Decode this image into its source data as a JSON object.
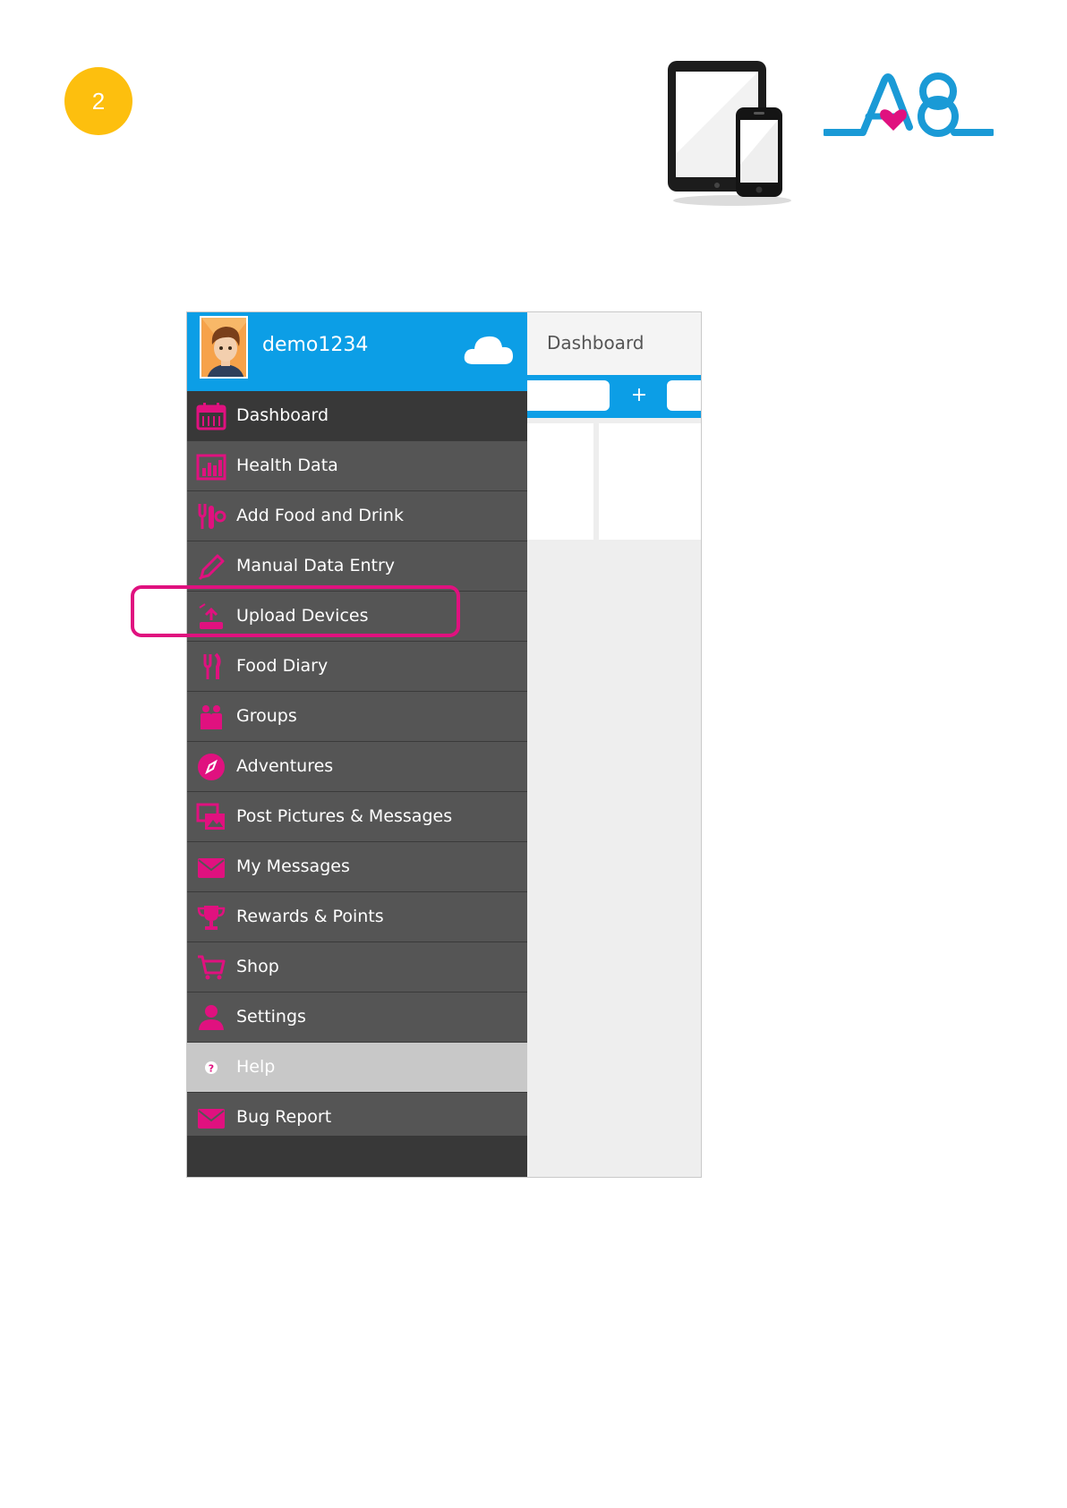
{
  "step": {
    "number": "2"
  },
  "colors": {
    "step_badge": "#fdbf0e",
    "app_blue": "#0c9ee6",
    "icon_pink": "#e0117f",
    "drawer_item": "#555555",
    "drawer_active": "#383838",
    "highlight": "#e0117f"
  },
  "header_art": {
    "devices_icon": "tablet-and-phone-icon",
    "logo_icon": "a8-logo-icon"
  },
  "drawer": {
    "username": "demo1234",
    "avatar_icon": "avatar-icon",
    "sync_icon": "cloud-icon",
    "items": [
      {
        "label": "Dashboard",
        "icon": "calendar-icon",
        "state": "active"
      },
      {
        "label": "Health Data",
        "icon": "chart-icon"
      },
      {
        "label": "Add Food and Drink",
        "icon": "utensils-icon"
      },
      {
        "label": "Manual Data Entry",
        "icon": "pencil-icon"
      },
      {
        "label": "Upload Devices",
        "icon": "upload-icon",
        "state": "highlighted"
      },
      {
        "label": "Food Diary",
        "icon": "fork-knife-icon"
      },
      {
        "label": "Groups",
        "icon": "people-icon"
      },
      {
        "label": "Adventures",
        "icon": "compass-icon"
      },
      {
        "label": "Post Pictures & Messages",
        "icon": "pictures-icon"
      },
      {
        "label": "My Messages",
        "icon": "envelope-icon"
      },
      {
        "label": "Rewards & Points",
        "icon": "trophy-icon"
      },
      {
        "label": "Shop",
        "icon": "cart-icon"
      },
      {
        "label": "Settings",
        "icon": "person-icon"
      },
      {
        "label": "Help",
        "icon": "question-icon",
        "state": "help"
      },
      {
        "label": "Bug Report",
        "icon": "envelope-icon"
      }
    ]
  },
  "content": {
    "title": "Dashboard",
    "add_tab_label": "+"
  }
}
